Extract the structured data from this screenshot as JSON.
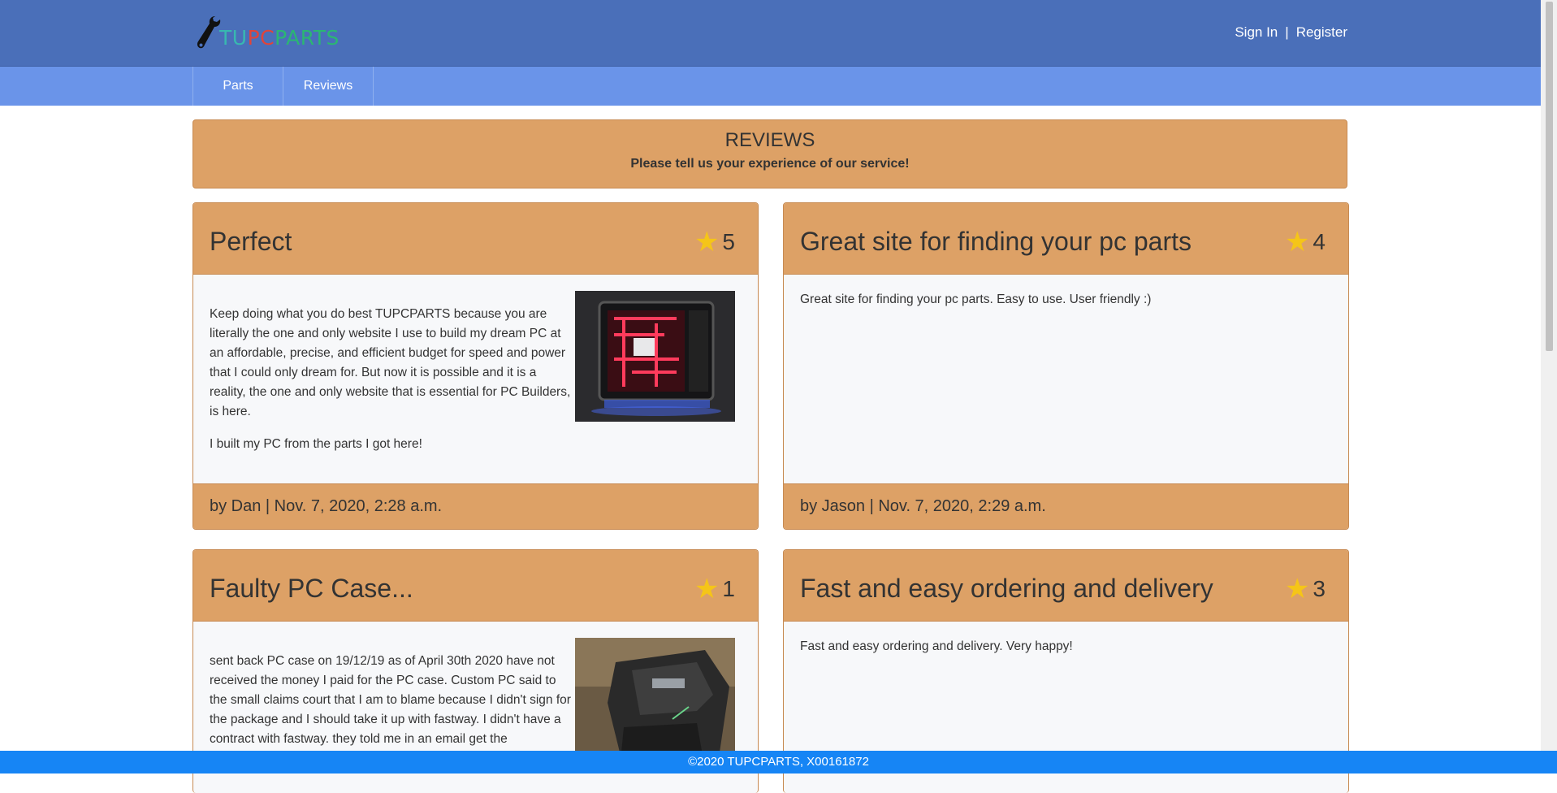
{
  "brand": {
    "logo_text_tu": "TU",
    "logo_text_pc": "PC",
    "logo_text_parts": "PARTS",
    "colors": {
      "tu": "#38b8b0",
      "pc": "#e0443a",
      "parts": "#2bb673"
    }
  },
  "auth": {
    "sign_in": "Sign In",
    "separator": "|",
    "register": "Register"
  },
  "nav": {
    "items": [
      {
        "label": "Parts"
      },
      {
        "label": "Reviews"
      }
    ]
  },
  "banner": {
    "title": "REVIEWS",
    "subtitle": "Please tell us your experience of our service!"
  },
  "reviews": [
    {
      "title": "Perfect",
      "rating": "5",
      "body": [
        "Keep doing what you do best TUPCPARTS because you are literally the one and only website I use to build my dream PC at an affordable, precise, and efficient budget for speed and power that I could only dream for. But now it is possible and it is a reality, the one and only website that is essential for PC Builders, is here.",
        "I built my PC from the parts I got here!"
      ],
      "footer": "by Dan | Nov. 7, 2020, 2:28 a.m."
    },
    {
      "title": "Great site for finding your pc parts",
      "rating": "4",
      "body": [
        "Great site for finding your pc parts. Easy to use. User friendly :)"
      ],
      "footer": "by Jason | Nov. 7, 2020, 2:29 a.m."
    },
    {
      "title": "Faulty PC Case...",
      "rating": "1",
      "body": [
        "sent back PC case on 19/12/19 as of April 30th 2020 have not received the money I paid for the PC case. Custom PC said to the small claims court that I am to blame because I didn't sign for the package and I should take it up with fastway. I didn't have a contract with fastway. they told me in an email get the"
      ]
    },
    {
      "title": "Fast and easy ordering and delivery",
      "rating": "3",
      "body": [
        "Fast and easy ordering and delivery. Very happy!"
      ]
    }
  ],
  "footer": {
    "text": "©2020 TUPCPARTS, X00161872"
  }
}
